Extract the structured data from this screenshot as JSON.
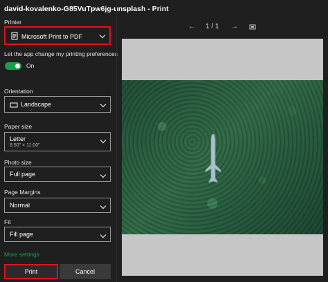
{
  "window": {
    "title": "david-kovalenko-G85VuTpw6jg-unsplash - Print"
  },
  "left_panel": {
    "printer_label": "Printer",
    "printer_value": "Microsoft Print to PDF",
    "change_pref_label": "Let the app change my printing preferences",
    "toggle_state": "On",
    "orientation_label": "Orientation",
    "orientation_value": "Landscape",
    "paper_size_label": "Paper size",
    "paper_size_value": "Letter",
    "paper_size_detail": "8.50\" × 11.00\"",
    "photo_size_label": "Photo size",
    "photo_size_value": "Full page",
    "margins_label": "Page Margins",
    "margins_value": "Normal",
    "fit_label": "Fit",
    "fit_value": "Fill page",
    "more_settings": "More settings",
    "print_button": "Print",
    "cancel_button": "Cancel"
  },
  "preview": {
    "page_indicator": "1 / 1",
    "accent_color": "#19a04a",
    "highlight_color": "#e3101e"
  }
}
